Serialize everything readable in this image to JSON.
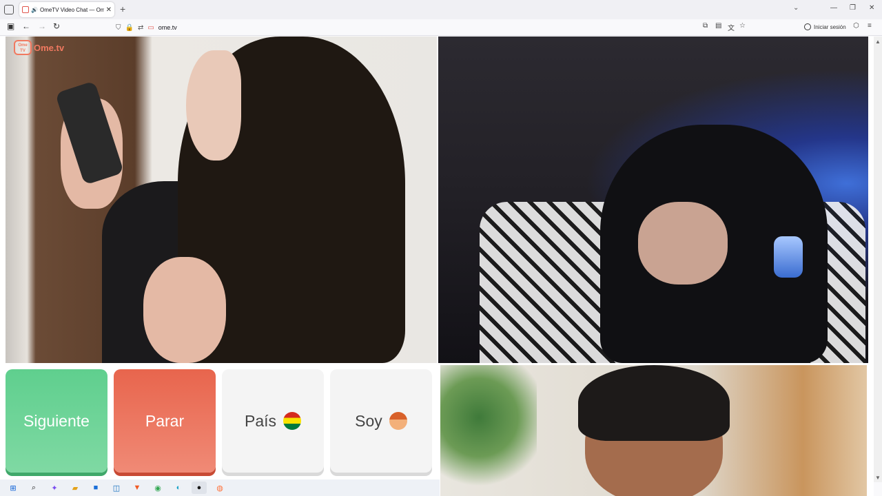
{
  "browser": {
    "tab": {
      "title": "OmeTV Video Chat — Ome",
      "sound_icon": "🔊",
      "close": "✕"
    },
    "new_tab": "+",
    "tabs_menu": "⌄",
    "window_controls": {
      "minimize": "—",
      "restore": "❐",
      "close": "✕"
    },
    "nav": {
      "back": "←",
      "forward": "→",
      "reload": "↻"
    },
    "address": {
      "url": "ome.tv"
    },
    "signin_label": "Iniciar sesión",
    "menu": "≡"
  },
  "site": {
    "logo_text": "Ome.tv",
    "logo_mark": "Ome TV"
  },
  "controls": {
    "next_label": "Siguiente",
    "stop_label": "Parar",
    "country_label": "País",
    "gender_label": "Soy"
  },
  "colors": {
    "next": "#5fcf8e",
    "stop": "#e8654d",
    "logo": "#f17960"
  },
  "taskbar": {
    "icons": [
      "windows-start-icon",
      "search-icon",
      "copilot-icon",
      "file-explorer-icon",
      "store-icon",
      "outlook-icon",
      "brave-icon",
      "chrome-icon",
      "edge-icon",
      "obs-icon",
      "firefox-icon"
    ]
  }
}
